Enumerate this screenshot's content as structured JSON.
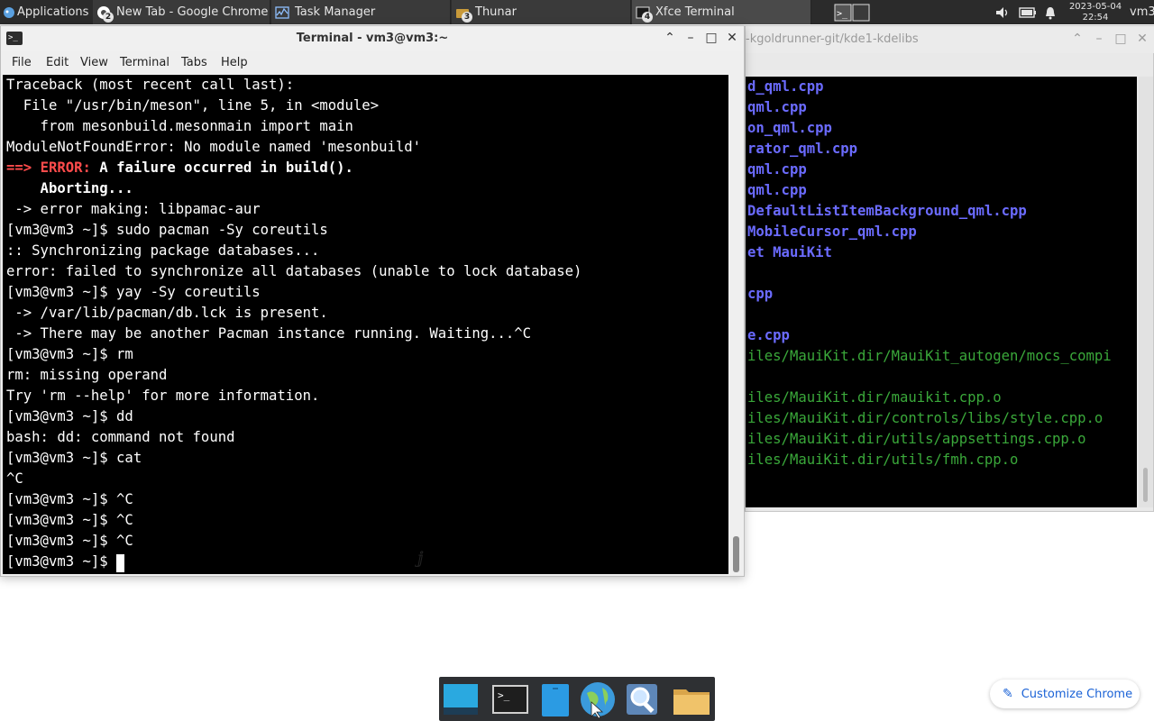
{
  "panel": {
    "apps_label": "Applications",
    "tasks": [
      {
        "num": "2",
        "label": "New Tab - Google Chrome",
        "icon": "chrome-icon"
      },
      {
        "num": "",
        "label": "Task Manager",
        "icon": "task-manager-icon"
      },
      {
        "num": "3",
        "label": "Thunar",
        "icon": "thunar-icon"
      },
      {
        "num": "4",
        "label": "Xfce Terminal",
        "icon": "terminal-icon"
      }
    ],
    "date": "2023-05-04",
    "time": "22:54",
    "user": "vm3"
  },
  "back_window": {
    "title": "-kgoldrunner-git/kde1-kdelibs",
    "lines": [
      {
        "text": "d_qml.cpp",
        "color": "blue"
      },
      {
        "text": "qml.cpp",
        "color": "blue"
      },
      {
        "text": "on_qml.cpp",
        "color": "blue"
      },
      {
        "text": "rator_qml.cpp",
        "color": "blue"
      },
      {
        "text": "qml.cpp",
        "color": "blue"
      },
      {
        "text": "qml.cpp",
        "color": "blue"
      },
      {
        "text": "DefaultListItemBackground_qml.cpp",
        "color": "blue"
      },
      {
        "text": "MobileCursor_qml.cpp",
        "color": "blue"
      },
      {
        "text": "et MauiKit",
        "color": "blue"
      },
      {
        "text": "",
        "color": "blue"
      },
      {
        "text": "cpp",
        "color": "blue"
      },
      {
        "text": "",
        "color": "blue"
      },
      {
        "text": "e.cpp",
        "color": "blue"
      },
      {
        "text": "iles/MauiKit.dir/MauiKit_autogen/mocs_compi",
        "color": "green"
      },
      {
        "text": "",
        "color": "green"
      },
      {
        "text": "iles/MauiKit.dir/mauikit.cpp.o",
        "color": "green"
      },
      {
        "text": "iles/MauiKit.dir/controls/libs/style.cpp.o",
        "color": "green"
      },
      {
        "text": "iles/MauiKit.dir/utils/appsettings.cpp.o",
        "color": "green"
      },
      {
        "text": "iles/MauiKit.dir/utils/fmh.cpp.o",
        "color": "green"
      }
    ]
  },
  "terminal": {
    "title": "Terminal - vm3@vm3:~",
    "menu": [
      "File",
      "Edit",
      "View",
      "Terminal",
      "Tabs",
      "Help"
    ],
    "lines": [
      "Traceback (most recent call last):",
      "  File \"/usr/bin/meson\", line 5, in <module>",
      "    from mesonbuild.mesonmain import main",
      "ModuleNotFoundError: No module named 'mesonbuild'",
      "",
      "    Aborting...",
      " -> error making: libpamac-aur",
      "[vm3@vm3 ~]$ sudo pacman -Sy coreutils",
      ":: Synchronizing package databases...",
      "error: failed to synchronize all databases (unable to lock database)",
      "[vm3@vm3 ~]$ yay -Sy coreutils",
      " -> /var/lib/pacman/db.lck is present.",
      " -> There may be another Pacman instance running. Waiting...^C",
      "[vm3@vm3 ~]$ rm",
      "rm: missing operand",
      "Try 'rm --help' for more information.",
      "[vm3@vm3 ~]$ dd",
      "bash: dd: command not found",
      "[vm3@vm3 ~]$ cat",
      "^C",
      "[vm3@vm3 ~]$ ^C",
      "[vm3@vm3 ~]$ ^C",
      "[vm3@vm3 ~]$ ^C",
      "[vm3@vm3 ~]$ "
    ],
    "error_line": {
      "arrow": "==>",
      "label": "ERROR:",
      "message": "A failure occurred in build()."
    }
  },
  "dock": {
    "items": [
      "show-desktop-icon",
      "terminal-icon",
      "file-manager-icon",
      "web-browser-icon",
      "app-finder-icon",
      "home-folder-icon"
    ]
  },
  "customize": {
    "label": "Customize Chrome"
  },
  "colors": {
    "terminal_bg": "#000000",
    "error_red": "#ff4b4b",
    "file_blue": "#6b6bff",
    "object_green": "#3aa83a",
    "chrome_blue": "#1a62d6"
  }
}
